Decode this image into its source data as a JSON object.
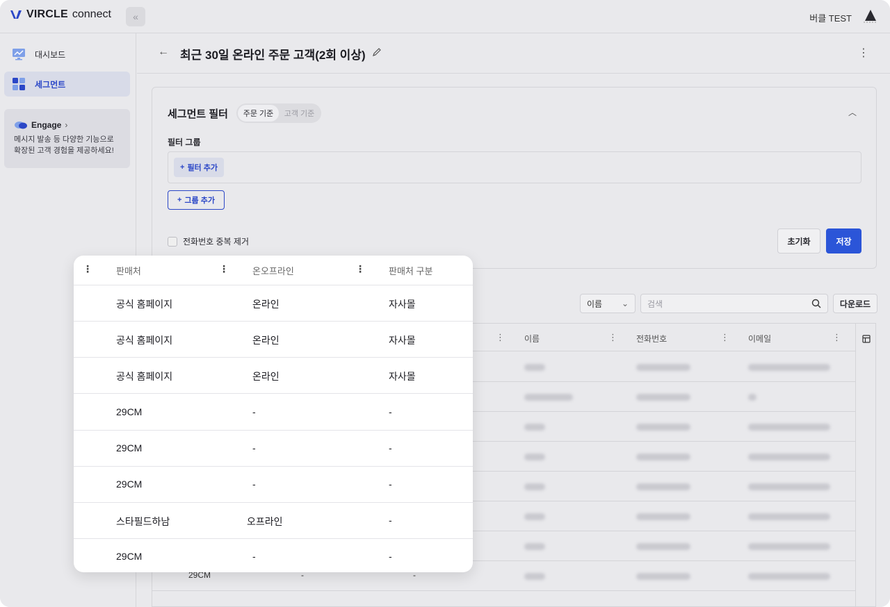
{
  "app": {
    "brand": "VIRCLE",
    "brand_sub": "connect",
    "user_name": "버클 TEST",
    "accent": "#2b55d8"
  },
  "sidebar": {
    "items": [
      {
        "label": "대시보드",
        "icon": "dashboard-icon"
      },
      {
        "label": "세그먼트",
        "icon": "segment-icon",
        "active": true
      }
    ],
    "engage": {
      "title": "Engage",
      "desc_line1": "메시지 발송 등 다양한 기능으로",
      "desc_line2": "확장된 고객 경험을 제공하세요!"
    }
  },
  "page": {
    "title": "최근 30일 온라인 주문 고객(2회 이상)"
  },
  "filter": {
    "title": "세그먼트 필터",
    "toggle": [
      "주문 기준",
      "고객 기준"
    ],
    "group_label": "필터 그룹",
    "add_filter": "필터 추가",
    "add_group": "그룹 추가",
    "dedupe_label": "전화번호 중복 제거",
    "reset": "초기화",
    "save": "저장"
  },
  "customer_table": {
    "select_value": "이름",
    "search_placeholder": "검색",
    "download": "다운로드",
    "headers": [
      "이름",
      "전화번호",
      "이메일"
    ],
    "last_row": [
      "29CM",
      "-",
      "-"
    ]
  },
  "overlay_table": {
    "headers": [
      "판매처",
      "온오프라인",
      "판매처 구분"
    ],
    "rows": [
      [
        "공식 홈페이지",
        "온라인",
        "자사몰"
      ],
      [
        "공식 홈페이지",
        "온라인",
        "자사몰"
      ],
      [
        "공식 홈페이지",
        "온라인",
        "자사몰"
      ],
      [
        "29CM",
        "-",
        "-"
      ],
      [
        "29CM",
        "-",
        "-"
      ],
      [
        "29CM",
        "-",
        "-"
      ],
      [
        "스타필드하남",
        "오프라인",
        "-"
      ],
      [
        "29CM",
        "-",
        "-"
      ]
    ]
  }
}
